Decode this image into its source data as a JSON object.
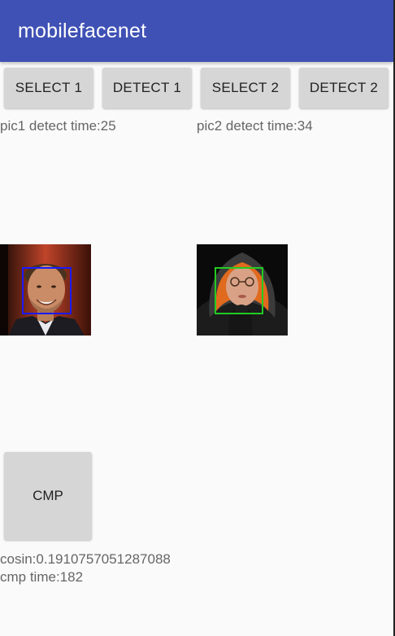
{
  "app_bar": {
    "title": "mobilefacenet",
    "color": "#3f51b5"
  },
  "buttons": {
    "select1": "SELECT 1",
    "detect1": "DETECT 1",
    "select2": "SELECT 2",
    "detect2": "DETECT 2",
    "cmp": "CMP"
  },
  "results": {
    "pic1_detect_time": "pic1 detect time:25",
    "pic2_detect_time": "pic2 detect time:34",
    "cosin": "cosin:0.1910757051287088",
    "cmp_time": "cmp time:182"
  },
  "images": {
    "pic1": {
      "face_box_color": "#1a1aff"
    },
    "pic2": {
      "face_box_color": "#22cc22"
    }
  }
}
